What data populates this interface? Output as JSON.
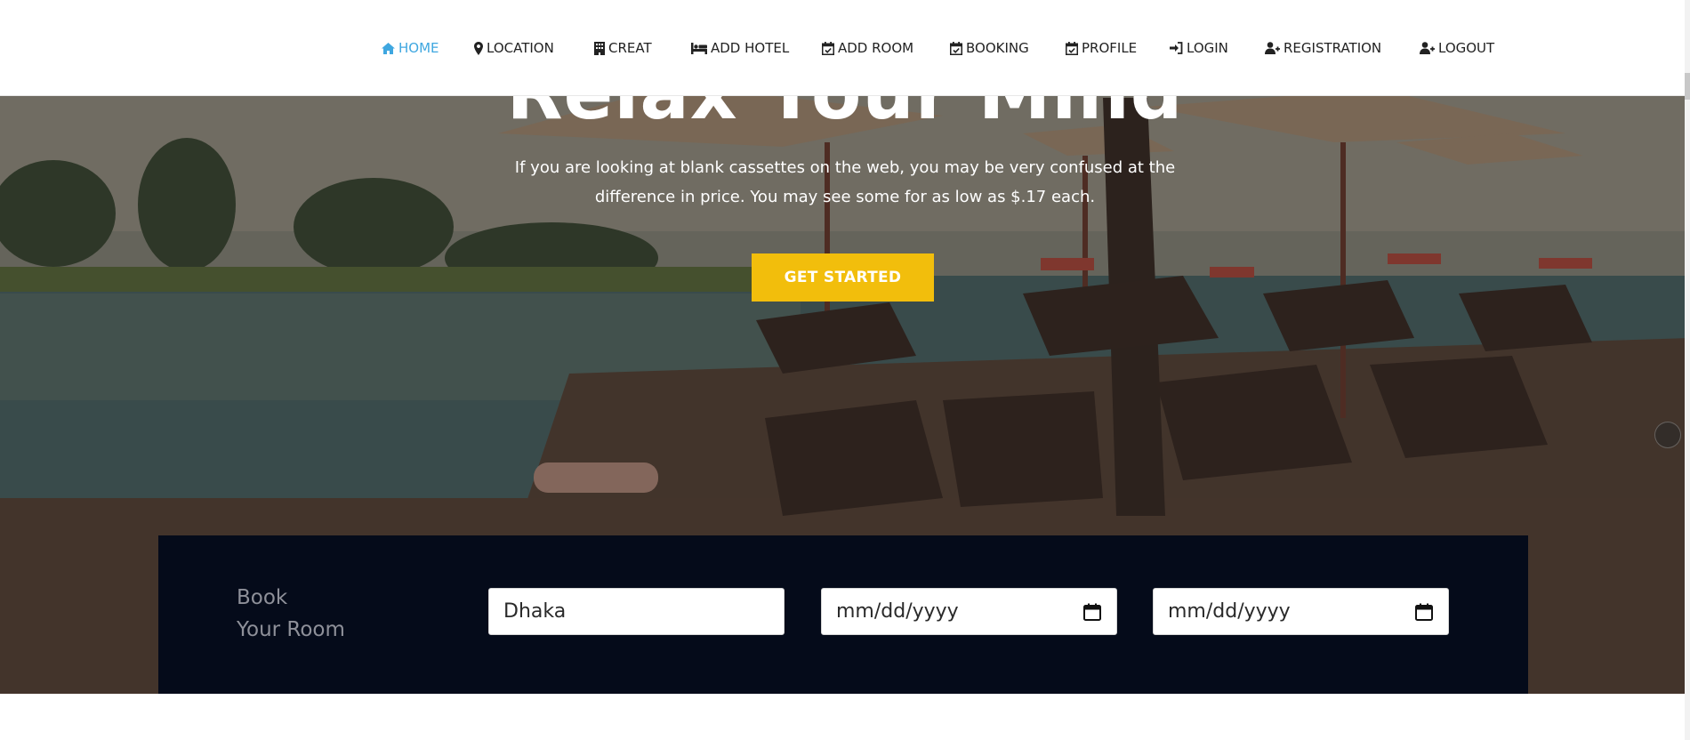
{
  "nav": {
    "items": [
      {
        "label": "HOME",
        "icon": "home-icon",
        "active": true
      },
      {
        "label": "LOCATION",
        "icon": "map-marker-icon",
        "active": false
      },
      {
        "label": "CREAT",
        "icon": "building-icon",
        "active": false
      },
      {
        "label": "ADD HOTEL",
        "icon": "bed-icon",
        "active": false
      },
      {
        "label": "ADD ROOM",
        "icon": "calendar-check-icon",
        "active": false
      },
      {
        "label": "BOOKING",
        "icon": "calendar-check-icon",
        "active": false
      },
      {
        "label": "PROFILE",
        "icon": "calendar-check-icon",
        "active": false
      },
      {
        "label": "LOGIN",
        "icon": "sign-in-icon",
        "active": false
      },
      {
        "label": "REGISTRATION",
        "icon": "user-plus-icon",
        "active": false
      },
      {
        "label": "LOGOUT",
        "icon": "user-plus-icon",
        "active": false
      }
    ],
    "active_color": "#3fa7e0"
  },
  "hero": {
    "title": "Relax Your Mind",
    "text": "If you are looking at blank cassettes on the web, you may be very confused at the difference in price. You may see some for as low as $.17 each.",
    "button_label": "GET STARTED",
    "button_color": "#f2be0c"
  },
  "booking": {
    "title_line1": "Book",
    "title_line2": "Your Room",
    "location_value": "Dhaka",
    "checkin_placeholder": "mm/dd/yyyy",
    "checkout_placeholder": "mm/dd/yyyy",
    "background_color": "#050b1a"
  }
}
